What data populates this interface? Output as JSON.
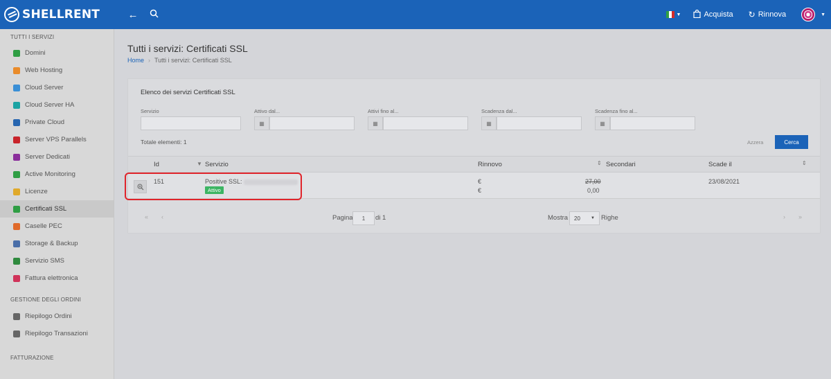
{
  "brand": {
    "name": "SHELLRENT"
  },
  "topbar": {
    "back_icon": "arrow-left-icon",
    "search_icon": "search-icon",
    "flag_colors": [
      "#2f9e44",
      "#ffffff",
      "#d42b2b"
    ],
    "acquista": "Acquista",
    "rinnova": "Rinnova"
  },
  "sidebar": {
    "section_services": "TUTTI I SERVIZI",
    "items": [
      {
        "label": "Domini",
        "color": "#2f9e44"
      },
      {
        "label": "Web Hosting",
        "color": "#e98b2a"
      },
      {
        "label": "Cloud Server",
        "color": "#3a8fd6"
      },
      {
        "label": "Cloud Server HA",
        "color": "#1ba3a3"
      },
      {
        "label": "Private Cloud",
        "color": "#2766b0"
      },
      {
        "label": "Server VPS Parallels",
        "color": "#c8242b"
      },
      {
        "label": "Server Dedicati",
        "color": "#8a2e9b"
      },
      {
        "label": "Active Monitoring",
        "color": "#2f9e44"
      },
      {
        "label": "Licenze",
        "color": "#e0a92a"
      },
      {
        "label": "Certificati SSL",
        "color": "#2f9e44"
      },
      {
        "label": "Caselle PEC",
        "color": "#e06a2a"
      },
      {
        "label": "Storage & Backup",
        "color": "#4a6ea8"
      },
      {
        "label": "Servizio SMS",
        "color": "#2f8a3e"
      },
      {
        "label": "Fattura elettronica",
        "color": "#d0335a"
      }
    ],
    "section_orders": "GESTIONE DEGLI ORDINI",
    "order_items": [
      {
        "label": "Riepilogo Ordini",
        "color": "#666666"
      },
      {
        "label": "Riepilogo Transazioni",
        "color": "#666666"
      }
    ],
    "section_billing": "FATTURAZIONE"
  },
  "page": {
    "title": "Tutti i servizi: Certificati SSL",
    "breadcrumb_home": "Home",
    "breadcrumb_current": "Tutti i servizi: Certificati SSL"
  },
  "panel": {
    "title": "Elenco dei servizi Certificati SSL",
    "filters": {
      "servizio": "Servizio",
      "attivo_dal": "Attivo dal...",
      "attivi_fino": "Attivi fino al...",
      "scadenza_dal": "Scadenza dal...",
      "scadenza_fino": "Scadenza fino al..."
    },
    "totale": "Totale elementi: 1",
    "reset": "Azzera",
    "search": "Cerca"
  },
  "table": {
    "headers": {
      "id": "Id",
      "servizio": "Servizio",
      "rinnovo": "Rinnovo",
      "secondari": "Secondari",
      "scade": "Scade il"
    },
    "row": {
      "id": "151",
      "servizio": "Positive SSL:",
      "status": "Attivo",
      "currency": "€",
      "price_old": "27,00",
      "price_new": "0,00",
      "scade": "23/08/2021"
    }
  },
  "pager": {
    "pagina": "Pagina",
    "page_value": "1",
    "di": "di 1",
    "mostra": "Mostra",
    "per_page": "20",
    "righe": "Righe"
  }
}
